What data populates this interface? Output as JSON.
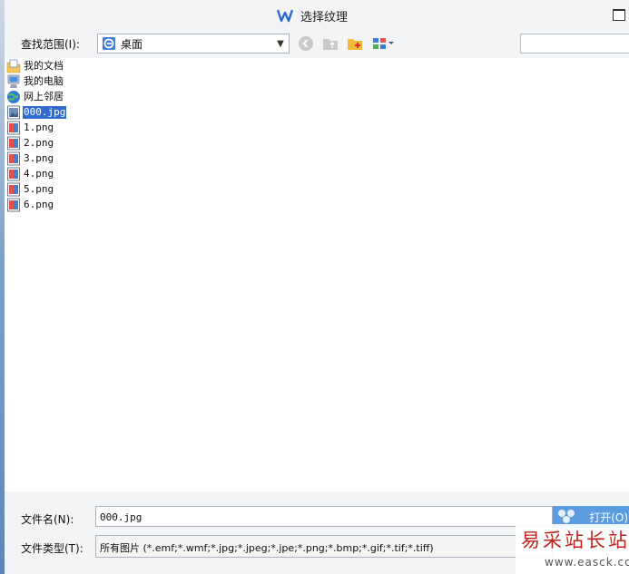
{
  "window": {
    "title": "选择纹理"
  },
  "toolbar": {
    "lookin_label": "查找范围(I):",
    "lookin_value": "桌面",
    "buttons": [
      "back-icon",
      "up-folder-icon",
      "new-folder-icon",
      "view-menu-icon"
    ]
  },
  "files": [
    {
      "name": "我的文档",
      "icon": "my-documents-icon"
    },
    {
      "name": "我的电脑",
      "icon": "my-computer-icon"
    },
    {
      "name": "网上邻居",
      "icon": "network-icon"
    },
    {
      "name": "000.jpg",
      "icon": "image-file-icon",
      "selected": true
    },
    {
      "name": "1.png",
      "icon": "image-file-icon"
    },
    {
      "name": "2.png",
      "icon": "image-file-icon"
    },
    {
      "name": "3.png",
      "icon": "image-file-icon"
    },
    {
      "name": "4.png",
      "icon": "image-file-icon"
    },
    {
      "name": "5.png",
      "icon": "image-file-icon"
    },
    {
      "name": "6.png",
      "icon": "image-file-icon"
    }
  ],
  "bottom": {
    "filename_label": "文件名(N):",
    "filename_value": "000.jpg",
    "filetype_label": "文件类型(T):",
    "filetype_value": "所有图片 (*.emf;*.wmf;*.jpg;*.jpeg;*.jpe;*.png;*.bmp;*.gif;*.tif;*.tiff)",
    "open_label": "打开(O)"
  },
  "watermark": {
    "title": "易采站长站",
    "url": "www.easck.com"
  },
  "colors": {
    "selection": "#2f6bd1",
    "open_button": "#5b9be0",
    "watermark": "#c0241c"
  }
}
